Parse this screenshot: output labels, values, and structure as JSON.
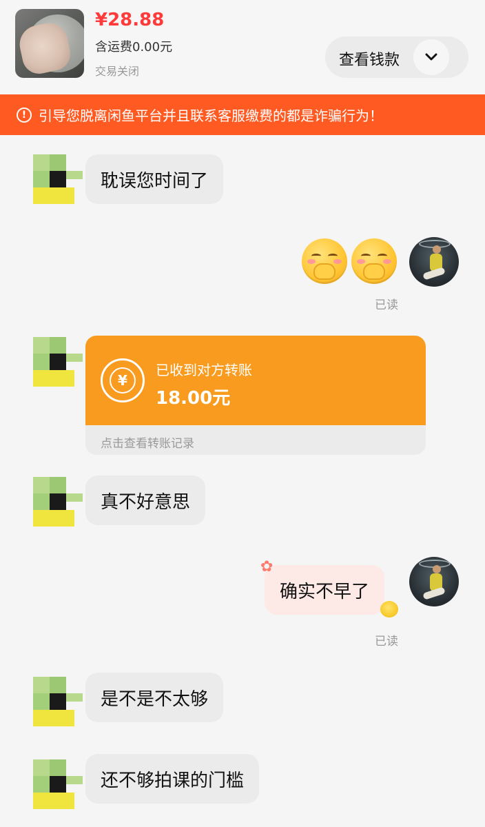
{
  "header": {
    "price": "¥28.88",
    "shipping": "含运费0.00元",
    "status": "交易关闭",
    "view_money_label": "查看钱款"
  },
  "warning": {
    "text": "引导您脱离闲鱼平台并且联系客服缴费的都是诈骗行为！",
    "icon": "exclamation-circle-icon"
  },
  "messages": [
    {
      "from": "other",
      "text": "耽误您时间了"
    },
    {
      "from": "me",
      "type": "emoji",
      "emoji": "shy-smile-emoji",
      "count": 2,
      "read": "已读"
    },
    {
      "from": "other",
      "type": "transfer",
      "title": "已收到对方转账",
      "amount": "18.00元",
      "link": "点击查看转账记录"
    },
    {
      "from": "other",
      "text": "真不好意思"
    },
    {
      "from": "me",
      "text": "确实不早了",
      "read": "已读"
    },
    {
      "from": "other",
      "text": "是不是不太够"
    },
    {
      "from": "other",
      "text": "还不够拍课的门槛"
    }
  ],
  "colors": {
    "price": "#ff3a3a",
    "warning_bg": "#ff5a22",
    "transfer_bg": "#f99b1e",
    "bubble_other": "#ebebeb",
    "bubble_me": "#fde9e6"
  }
}
